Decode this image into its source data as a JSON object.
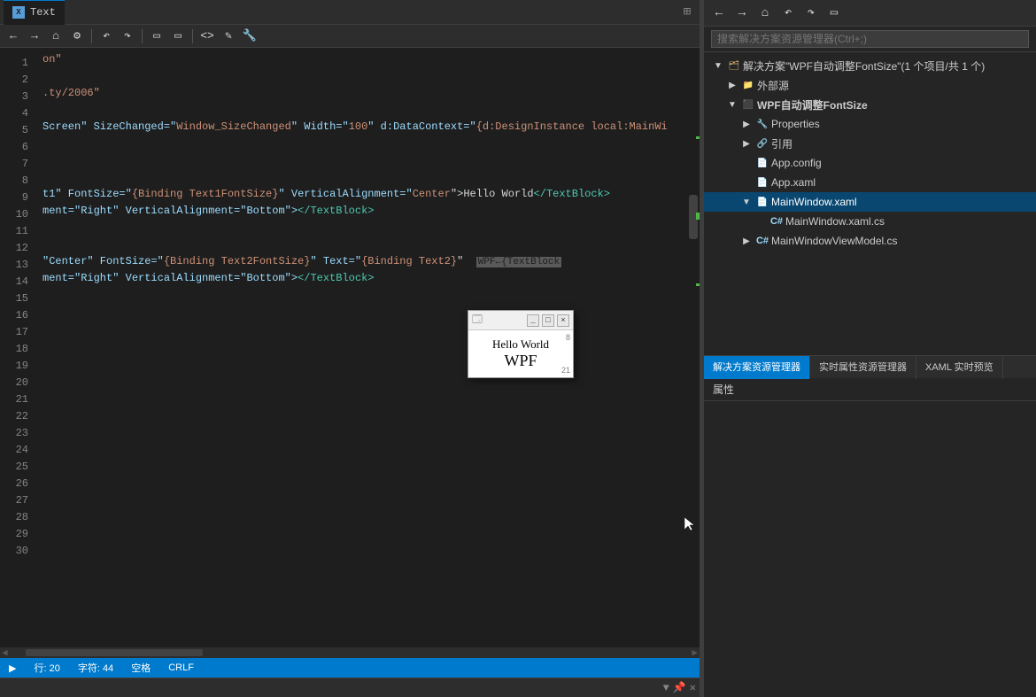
{
  "editor": {
    "tab_label": "Text",
    "tab_icon": "X",
    "toolbar_icons": [
      "←",
      "→",
      "⌂",
      "⚙",
      "↶",
      "↷",
      "▭",
      "▭",
      "<>",
      "✎",
      "🔧"
    ],
    "code_lines": [
      {
        "num": "",
        "text": "on\"",
        "parts": [
          {
            "t": "on\"",
            "c": "c-string"
          }
        ]
      },
      {
        "num": "",
        "text": ""
      },
      {
        "num": "",
        "text": ".ty/2006\"",
        "parts": [
          {
            "t": ".ty/2006\"",
            "c": "c-string"
          }
        ]
      },
      {
        "num": "",
        "text": ""
      },
      {
        "num": "",
        "text": "Screen\" SizeChanged=\"Window_SizeChanged\" Width=\"100\" d:DataContext=\"{d:DesignInstance local:MainWi",
        "parts": [
          {
            "t": "Screen\" SizeChanged=\"",
            "c": "c-attr"
          },
          {
            "t": "Window_SizeChanged",
            "c": "c-value"
          },
          {
            "t": "\" Width=\"",
            "c": "c-attr"
          },
          {
            "t": "100",
            "c": "c-value"
          },
          {
            "t": "\" d:DataContext=\"",
            "c": "c-attr"
          },
          {
            "t": "{d:DesignInstance local:MainWi",
            "c": "c-string"
          }
        ]
      },
      {
        "num": "",
        "text": ""
      },
      {
        "num": "",
        "text": ""
      },
      {
        "num": "",
        "text": ""
      },
      {
        "num": "",
        "text": "t1\" FontSize=\"{Binding Text1FontSize}\" VerticalAlignment=\"Center\">Hello World</TextBlock>",
        "parts": [
          {
            "t": "t1\" FontSize=\"",
            "c": "c-attr"
          },
          {
            "t": "{Binding Text1FontSize}",
            "c": "c-string"
          },
          {
            "t": "\" VerticalAlignment=\"",
            "c": "c-attr"
          },
          {
            "t": "Center",
            "c": "c-value"
          },
          {
            "t": "\">",
            "c": "c-white"
          },
          {
            "t": "Hello World",
            "c": "c-white"
          },
          {
            "t": "</",
            "c": "c-blue"
          },
          {
            "t": "TextBlock",
            "c": "c-blue"
          },
          {
            "t": ">",
            "c": "c-blue"
          }
        ]
      },
      {
        "num": "",
        "text": "ment=\"Right\" VerticalAlignment=\"Bottom\"></TextBlock>",
        "parts": [
          {
            "t": "ment=\"Right\" VerticalAlignment=\"Bottom\">",
            "c": "c-attr"
          },
          {
            "t": "</",
            "c": "c-blue"
          },
          {
            "t": "TextBlock",
            "c": "c-blue"
          },
          {
            "t": ">",
            "c": "c-blue"
          }
        ]
      },
      {
        "num": "",
        "text": ""
      },
      {
        "num": "",
        "text": ""
      },
      {
        "num": "",
        "text": "\"Center\" FontSize=\"{Binding Text2FontSize}\" Text=\"{Binding Text2}\"",
        "parts": [
          {
            "t": "\"Center\" FontSize=\"",
            "c": "c-attr"
          },
          {
            "t": "{Binding Text2FontSize}",
            "c": "c-string"
          },
          {
            "t": "\" Text=\"",
            "c": "c-attr"
          },
          {
            "t": "{Binding Text2}",
            "c": "c-string"
          },
          {
            "t": "\"",
            "c": "c-white"
          }
        ]
      },
      {
        "num": "",
        "text": "ment=\"Right\" VerticalAlignment=\"Bottom\"></TextBlock>",
        "parts": [
          {
            "t": "ment=\"Right\" VerticalAlignment=\"Bottom\">",
            "c": "c-attr"
          },
          {
            "t": "</",
            "c": "c-blue"
          },
          {
            "t": "TextBlock",
            "c": "c-blue"
          },
          {
            "t": ">",
            "c": "c-blue"
          }
        ]
      }
    ],
    "h_scrollbar_label": "",
    "status": {
      "row": "行: 20",
      "col": "字符: 44",
      "space": "空格",
      "encoding": "CRLF"
    }
  },
  "right_panel": {
    "toolbar_icons": [
      "←",
      "→",
      "⌂",
      "↶",
      "↷",
      "▭"
    ],
    "search_placeholder": "搜索解决方案资源管理器(Ctrl+;)",
    "search_label": "搜索解决方案资源管理器(Ctrl+;)",
    "tree": {
      "solution_label": "解决方案\"WPF自动调整FontSize\"(1 个项目/共 1 个)",
      "external_label": "外部源",
      "project_label": "WPF自动调整FontSize",
      "properties_label": "Properties",
      "references_label": "引用",
      "appconfig_label": "App.config",
      "appxaml_label": "App.xaml",
      "mainwindow_label": "MainWindow.xaml",
      "mainwindow_cs_label": "MainWindow.xaml.cs",
      "mainwindow_viewmodel_label": "MainWindowViewModel.cs"
    },
    "bottom_tabs": [
      {
        "label": "解决方案资源管理器",
        "active": true
      },
      {
        "label": "实时属性资源管理器",
        "active": false
      },
      {
        "label": "XAML 实时预览",
        "active": false
      }
    ],
    "properties_section": "属性"
  },
  "wpf_popup": {
    "title_icon": "🗔",
    "btn_minimize": "_",
    "btn_maximize": "□",
    "btn_close": "×",
    "text1": "Hello World",
    "text2": "WPF",
    "badge1": "8",
    "badge2": "21"
  },
  "colors": {
    "editor_bg": "#1e1e1e",
    "panel_bg": "#252526",
    "accent": "#007acc",
    "tab_active": "#094771"
  }
}
